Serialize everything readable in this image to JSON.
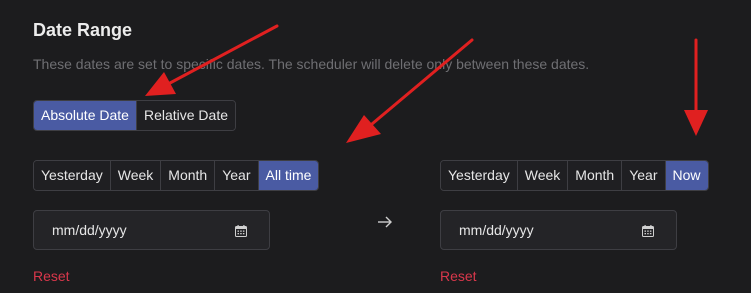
{
  "section": {
    "title": "Date Range",
    "description": "These dates are set to specific dates. The scheduler will delete only between these dates."
  },
  "mode_toggle": {
    "options": [
      "Absolute Date",
      "Relative Date"
    ],
    "selected": "Absolute Date"
  },
  "from": {
    "quick": [
      "Yesterday",
      "Week",
      "Month",
      "Year",
      "All time"
    ],
    "selected": "All time",
    "date_placeholder": "mm/dd/yyyy",
    "reset_label": "Reset"
  },
  "separator_icon": "arrow-right-icon",
  "to": {
    "quick": [
      "Yesterday",
      "Week",
      "Month",
      "Year",
      "Now"
    ],
    "selected": "Now",
    "date_placeholder": "mm/dd/yyyy",
    "reset_label": "Reset"
  },
  "colors": {
    "background": "#1c1c1e",
    "accent": "#4a5ba3",
    "danger": "#d9374b",
    "annotation_arrow": "#e02020"
  }
}
